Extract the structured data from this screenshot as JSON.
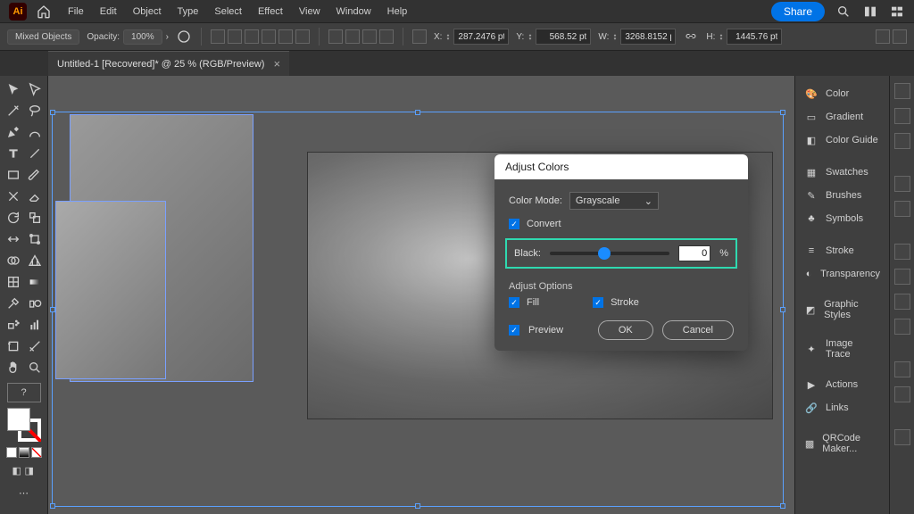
{
  "menubar": {
    "items": [
      "File",
      "Edit",
      "Object",
      "Type",
      "Select",
      "Effect",
      "View",
      "Window",
      "Help"
    ],
    "share": "Share"
  },
  "optionsbar": {
    "selection": "Mixed Objects",
    "opacity_label": "Opacity:",
    "opacity_value": "100%",
    "x_label": "X:",
    "x_value": "287.2476 pt",
    "y_label": "Y:",
    "y_value": "568.52 pt",
    "w_label": "W:",
    "w_value": "3268.8152 p",
    "h_label": "H:",
    "h_value": "1445.76 pt"
  },
  "document": {
    "tab_title": "Untitled-1 [Recovered]* @ 25 % (RGB/Preview)"
  },
  "dialog": {
    "title": "Adjust Colors",
    "color_mode_label": "Color Mode:",
    "color_mode_value": "Grayscale",
    "convert_label": "Convert",
    "black_label": "Black:",
    "black_value": "0",
    "black_unit": "%",
    "adjust_options_label": "Adjust Options",
    "fill_label": "Fill",
    "stroke_label": "Stroke",
    "preview_label": "Preview",
    "ok": "OK",
    "cancel": "Cancel"
  },
  "panels": {
    "items": [
      "Color",
      "Gradient",
      "Color Guide",
      "Swatches",
      "Brushes",
      "Symbols",
      "Stroke",
      "Transparency",
      "Graphic Styles",
      "Image Trace",
      "Actions",
      "Links",
      "QRCode Maker..."
    ]
  }
}
